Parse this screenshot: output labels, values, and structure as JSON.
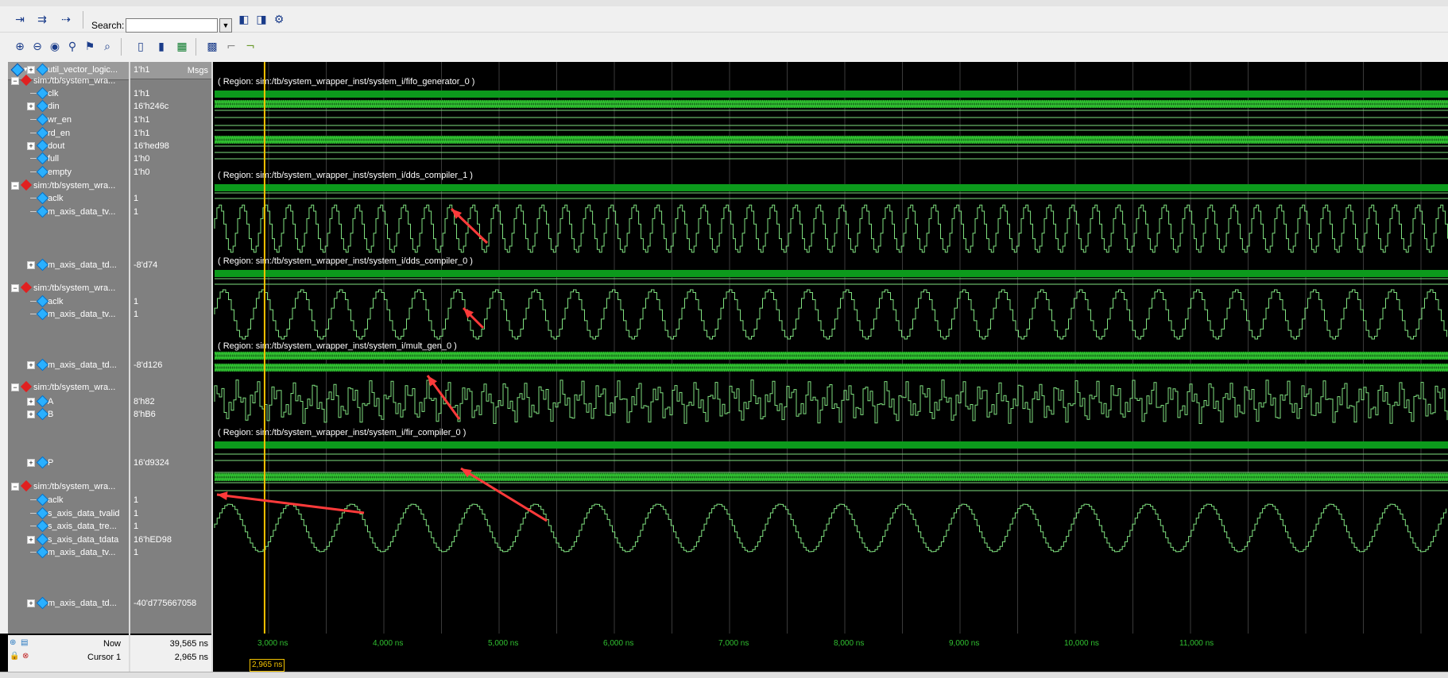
{
  "toolbar": {
    "search_label": "Search:",
    "search_value": "",
    "icons": [
      "step-into-icon",
      "step-over-icon",
      "step-out-icon",
      "find-icon",
      "find-prev-icon",
      "find-next-icon",
      "filter-icon",
      "zoom-in-icon",
      "zoom-out-icon",
      "zoom-full-icon",
      "zoom-cursor-icon",
      "zoom-marker-icon",
      "zoom-range-icon",
      "wave-expand-icon",
      "wave-collapse-icon",
      "wave-fill-icon",
      "wave-grid-icon",
      "wave-edge-left-icon",
      "wave-edge-right-icon"
    ]
  },
  "header": {
    "values_title": "Msgs"
  },
  "rows": [
    {
      "name": "util_vector_logic...",
      "value": "1'h1",
      "level": 2,
      "kind": "signal",
      "expandable": true
    },
    {
      "name": "sim:/tb/system_wra...",
      "value": "",
      "level": 0,
      "kind": "group",
      "expandable": true
    },
    {
      "name": "clk",
      "value": "1'h1",
      "level": 1,
      "kind": "signal",
      "expandable": false
    },
    {
      "name": "din",
      "value": "16'h246c",
      "level": 1,
      "kind": "signal",
      "expandable": true
    },
    {
      "name": "wr_en",
      "value": "1'h1",
      "level": 1,
      "kind": "signal",
      "expandable": false
    },
    {
      "name": "rd_en",
      "value": "1'h1",
      "level": 1,
      "kind": "signal",
      "expandable": false
    },
    {
      "name": "dout",
      "value": "16'hed98",
      "level": 1,
      "kind": "signal",
      "expandable": true
    },
    {
      "name": "full",
      "value": "1'h0",
      "level": 1,
      "kind": "signal",
      "expandable": false
    },
    {
      "name": "empty",
      "value": "1'h0",
      "level": 1,
      "kind": "signal",
      "expandable": false
    },
    {
      "name": "sim:/tb/system_wra...",
      "value": "",
      "level": 0,
      "kind": "group",
      "expandable": true
    },
    {
      "name": "aclk",
      "value": "1",
      "level": 1,
      "kind": "signal",
      "expandable": false
    },
    {
      "name": "m_axis_data_tv...",
      "value": "1",
      "level": 1,
      "kind": "signal",
      "expandable": false
    },
    {
      "name": "m_axis_data_td...",
      "value": "-8'd74",
      "level": 1,
      "kind": "signal",
      "expandable": true
    },
    {
      "name": "sim:/tb/system_wra...",
      "value": "",
      "level": 0,
      "kind": "group",
      "expandable": true
    },
    {
      "name": "aclk",
      "value": "1",
      "level": 1,
      "kind": "signal",
      "expandable": false
    },
    {
      "name": "m_axis_data_tv...",
      "value": "1",
      "level": 1,
      "kind": "signal",
      "expandable": false
    },
    {
      "name": "m_axis_data_td...",
      "value": "-8'd126",
      "level": 1,
      "kind": "signal",
      "expandable": true
    },
    {
      "name": "sim:/tb/system_wra...",
      "value": "",
      "level": 0,
      "kind": "group",
      "expandable": true
    },
    {
      "name": "A",
      "value": "8'h82",
      "level": 1,
      "kind": "signal",
      "expandable": true
    },
    {
      "name": "B",
      "value": "8'hB6",
      "level": 1,
      "kind": "signal",
      "expandable": true
    },
    {
      "name": "P",
      "value": "16'd9324",
      "level": 1,
      "kind": "signal",
      "expandable": true
    },
    {
      "name": "sim:/tb/system_wra...",
      "value": "",
      "level": 0,
      "kind": "group",
      "expandable": true
    },
    {
      "name": "aclk",
      "value": "1",
      "level": 1,
      "kind": "signal",
      "expandable": false
    },
    {
      "name": "s_axis_data_tvalid",
      "value": "1",
      "level": 1,
      "kind": "signal",
      "expandable": false
    },
    {
      "name": "s_axis_data_tre...",
      "value": "1",
      "level": 1,
      "kind": "signal",
      "expandable": false
    },
    {
      "name": "s_axis_data_tdata",
      "value": "16'hED98",
      "level": 1,
      "kind": "signal",
      "expandable": true
    },
    {
      "name": "m_axis_data_tv...",
      "value": "1",
      "level": 1,
      "kind": "signal",
      "expandable": false
    },
    {
      "name": "m_axis_data_td...",
      "value": "-40'd775667058",
      "level": 1,
      "kind": "signal",
      "expandable": true
    }
  ],
  "regions": [
    "( Region: sim:/tb/system_wrapper_inst/system_i/fifo_generator_0 )",
    "( Region: sim:/tb/system_wrapper_inst/system_i/dds_compiler_1 )",
    "( Region: sim:/tb/system_wrapper_inst/system_i/dds_compiler_0 )",
    "( Region: sim:/tb/system_wrapper_inst/system_i/mult_gen_0 )",
    "( Region: sim:/tb/system_wrapper_inst/system_i/fir_compiler_0 )"
  ],
  "status": {
    "now_label": "Now",
    "now_value": "39,565 ns",
    "cursor_label": "Cursor 1",
    "cursor_value": "2,965 ns",
    "cursor_time": "2,965 ns"
  },
  "timeline": {
    "ticks": [
      "3,000 ns",
      "4,000 ns",
      "5,000 ns",
      "6,000 ns",
      "7,000 ns",
      "8,000 ns",
      "9,000 ns",
      "10,000 ns",
      "11,000 ns"
    ],
    "tick_times": [
      3000,
      4000,
      5000,
      6000,
      7000,
      8000,
      9000,
      10000,
      11000
    ],
    "cursor_ns": 2965
  },
  "colors": {
    "wave": "#7fe07f",
    "bus": "#32c832",
    "region_bar": "#0c9a1c",
    "cursor": "#f2c200",
    "grid": "#3a3a3a",
    "annotation_arrow": "#ff3a3a"
  }
}
